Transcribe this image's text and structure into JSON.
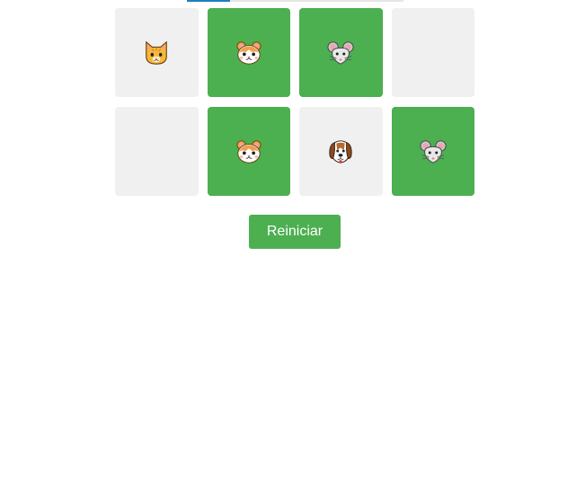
{
  "progress": 0.2,
  "colors": {
    "card_hidden": "#f0f0f0",
    "card_matched": "#4caf50",
    "button": "#4caf50",
    "progress_accent": "#1f7fc1"
  },
  "cards": [
    {
      "animal": "cat",
      "icon": "cat-face-icon",
      "state": "revealed"
    },
    {
      "animal": "hamster",
      "icon": "hamster-face-icon",
      "state": "matched"
    },
    {
      "animal": "mouse",
      "icon": "mouse-face-icon",
      "state": "matched"
    },
    {
      "animal": "",
      "icon": "",
      "state": "hidden"
    },
    {
      "animal": "",
      "icon": "",
      "state": "hidden"
    },
    {
      "animal": "hamster",
      "icon": "hamster-face-icon",
      "state": "matched"
    },
    {
      "animal": "dog",
      "icon": "dog-face-icon",
      "state": "revealed"
    },
    {
      "animal": "mouse",
      "icon": "mouse-face-icon",
      "state": "matched"
    }
  ],
  "restart_label": "Reiniciar"
}
